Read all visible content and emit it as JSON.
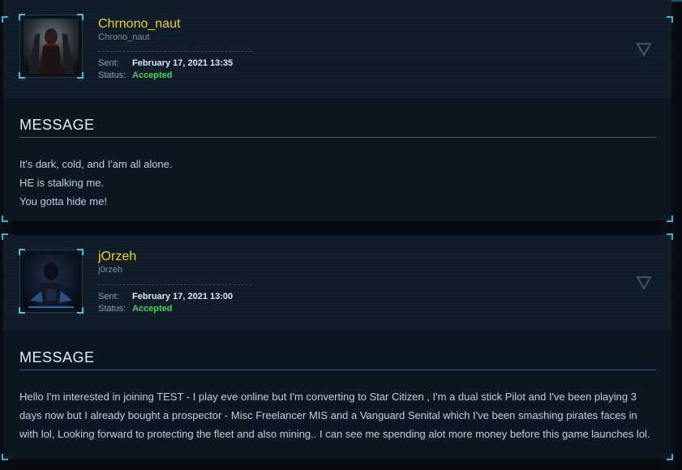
{
  "messages": [
    {
      "username": "Chrnono_naut",
      "handle": "Chrono_naut",
      "sent_label": "Sent:",
      "sent_value": "February 17, 2021 13:35",
      "status_label": "Status:",
      "status_value": "Accepted",
      "message_title": "MESSAGE",
      "lines": [
        "It's dark, cold, and I'am all alone.",
        "HE is stalking me.",
        "You gotta hide me!"
      ]
    },
    {
      "username": "jOrzeh",
      "handle": "j0rzeh",
      "sent_label": "Sent:",
      "sent_value": "February 17, 2021 13:00",
      "status_label": "Status:",
      "status_value": "Accepted",
      "message_title": "MESSAGE",
      "lines": [
        "Hello I'm interested in joining TEST - I play eve online but I'm converting to Star Citizen , I'm a dual stick Pilot and I've been playing 3 days now but I already bought a prospector - Misc Freelancer MIS and a Vanguard Senital which I've been smashing pirates faces in with lol, Looking forward to protecting the fleet and also mining.. I can see me spending alot more money before this game launches lol."
      ]
    }
  ],
  "colors": {
    "username": "#f5d20f",
    "accepted": "#39d65c",
    "accent_corner": "#2fb6d4"
  },
  "icons": {
    "toggle": "triangle-down-icon"
  }
}
